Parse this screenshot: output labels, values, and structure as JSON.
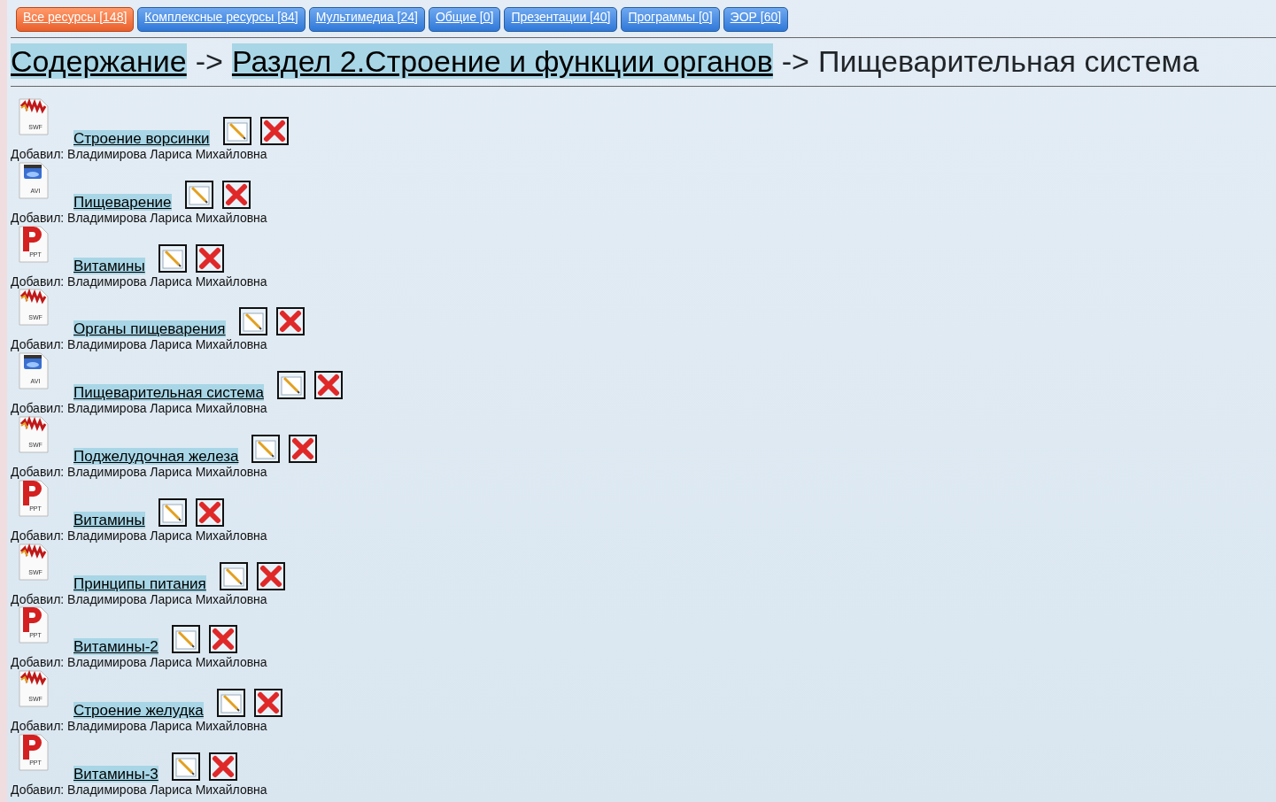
{
  "tabs": [
    {
      "label": "Все ресурсы [148]",
      "selected": true
    },
    {
      "label": "Комплексные ресурсы [84]",
      "selected": false
    },
    {
      "label": "Мультимедиа [24]",
      "selected": false
    },
    {
      "label": "Общие [0]",
      "selected": false
    },
    {
      "label": "Презентации [40]",
      "selected": false
    },
    {
      "label": "Программы [0]",
      "selected": false
    },
    {
      "label": "ЭОР [60]",
      "selected": false
    }
  ],
  "breadcrumb": [
    {
      "label": "Содержание",
      "kind": "link"
    },
    {
      "label": "->",
      "kind": "separator"
    },
    {
      "label": "Раздел 2.Строение и функции органов",
      "kind": "link"
    },
    {
      "label": "->",
      "kind": "separator"
    },
    {
      "label": "Пищеварительная система",
      "kind": "current"
    }
  ],
  "resources": [
    {
      "kind": "swf",
      "file_type": "SWF",
      "title": "Строение ворсинки",
      "author": "Добавил: Владимирова Лариса Михайловна"
    },
    {
      "kind": "avi",
      "file_type": "AVI",
      "title": "Пищеварение",
      "author": "Добавил: Владимирова Лариса Михайловна"
    },
    {
      "kind": "ppt",
      "file_type": "PPT",
      "title": "Витамины",
      "author": "Добавил: Владимирова Лариса Михайловна"
    },
    {
      "kind": "swf",
      "file_type": "SWF",
      "title": "Органы пищеварения",
      "author": "Добавил: Владимирова Лариса Михайловна"
    },
    {
      "kind": "avi",
      "file_type": "AVI",
      "title": "Пищеварительная система",
      "author": "Добавил: Владимирова Лариса Михайловна"
    },
    {
      "kind": "swf",
      "file_type": "SWF",
      "title": "Поджелудочная железа",
      "author": "Добавил: Владимирова Лариса Михайловна"
    },
    {
      "kind": "ppt",
      "file_type": "PPT",
      "title": "Витамины",
      "author": "Добавил: Владимирова Лариса Михайловна"
    },
    {
      "kind": "swf",
      "file_type": "SWF",
      "title": "Принципы питания",
      "author": "Добавил: Владимирова Лариса Михайловна"
    },
    {
      "kind": "ppt",
      "file_type": "PPT",
      "title": "Витамины-2",
      "author": "Добавил: Владимирова Лариса Михайловна"
    },
    {
      "kind": "swf",
      "file_type": "SWF",
      "title": "Строение желудка",
      "author": "Добавил: Владимирова Лариса Михайловна"
    },
    {
      "kind": "ppt",
      "file_type": "PPT",
      "title": "Витамины-3",
      "author": "Добавил: Владимирова Лариса Михайловна"
    }
  ]
}
